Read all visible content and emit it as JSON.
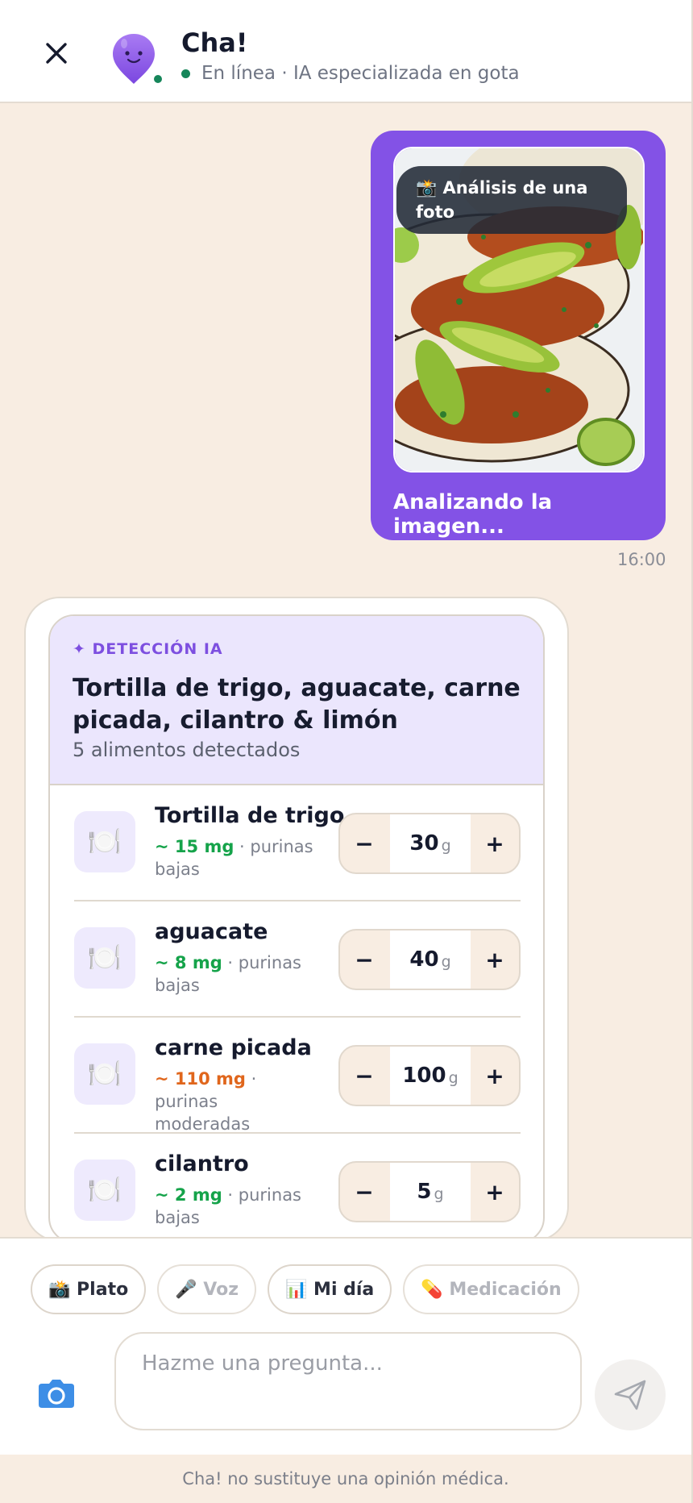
{
  "header": {
    "title": "Cha!",
    "status": "En línea · IA especializada en gota",
    "icons": {
      "close": "close-icon",
      "avatar": "drop-mascot-icon"
    }
  },
  "user_message": {
    "photo_badge": "📸 Análisis de una foto",
    "text": "Analizando la imagen...",
    "time": "16:00"
  },
  "detection": {
    "label": "✦ DETECCIÓN IA",
    "title": "Tortilla de trigo, aguacate, carne picada, cilantro & limón",
    "count": "5 alimentos detectados",
    "items": [
      {
        "icon": "🍽️",
        "name": "Tortilla de trigo",
        "mg": "~ 15 mg",
        "level": "low",
        "desc": " · purinas bajas",
        "qty": "30",
        "unit": "g"
      },
      {
        "icon": "🍽️",
        "name": "aguacate",
        "mg": "~ 8 mg",
        "level": "low",
        "desc": " · purinas bajas",
        "qty": "40",
        "unit": "g"
      },
      {
        "icon": "🍽️",
        "name": "carne picada",
        "mg": "~ 110 mg",
        "level": "moderate",
        "desc": " · purinas moderadas",
        "qty": "100",
        "unit": "g"
      },
      {
        "icon": "🍽️",
        "name": "cilantro",
        "mg": "~ 2 mg",
        "level": "low",
        "desc": " · purinas bajas",
        "qty": "5",
        "unit": "g"
      }
    ],
    "minus": "−",
    "plus": "+"
  },
  "chips": [
    {
      "label": "📸 Plato",
      "disabled": false
    },
    {
      "label": "🎤 Voz",
      "disabled": true
    },
    {
      "label": "📊 Mi día",
      "disabled": false
    },
    {
      "label": "💊 Medicación",
      "disabled": true
    }
  ],
  "composer": {
    "placeholder": "Hazme una pregunta...",
    "icons": {
      "camera": "camera-icon",
      "send": "send-icon"
    }
  },
  "disclaimer": "Cha! no sustituye una opinión médica.",
  "colors": {
    "accent": "#8352e6",
    "background": "#f8ede2",
    "online": "#16865a",
    "low": "#15a34a",
    "moderate": "#e0661c"
  }
}
